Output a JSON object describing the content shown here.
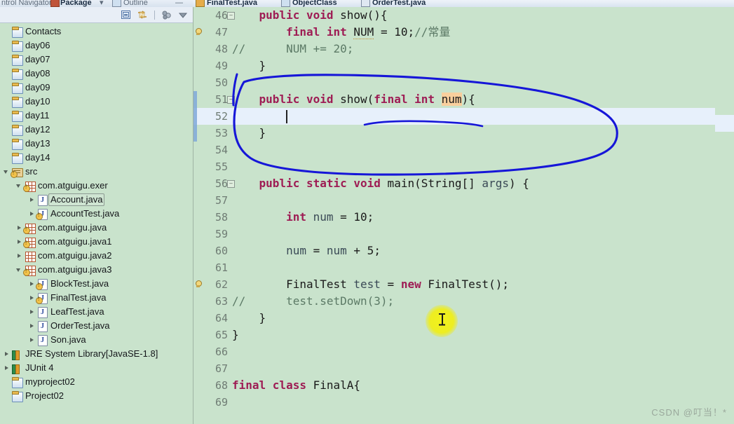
{
  "window": {
    "left_tabs": [
      {
        "label": "ntrol Navigator",
        "icon": "navigator-icon",
        "active": false
      },
      {
        "label": "Package",
        "icon": "package-explorer-icon",
        "active": true
      },
      {
        "label": "Outline",
        "icon": "outline-icon",
        "active": false
      }
    ],
    "editor_tabs": [
      {
        "label": "FinalTest.java",
        "icon": "java-file-icon",
        "active": true
      },
      {
        "label": "ObjectClass",
        "icon": "class-file-icon",
        "active": false
      },
      {
        "label": "OrderTest.java",
        "icon": "java-file-icon",
        "active": false
      }
    ]
  },
  "sidebar": {
    "toolbar": [
      {
        "name": "collapse-all-icon",
        "title": "Collapse All"
      },
      {
        "name": "link-with-editor-icon",
        "title": "Link with Editor"
      },
      {
        "name": "focus-on-active-task-icon",
        "title": "Focus"
      },
      {
        "name": "view-menu-icon",
        "title": "View Menu"
      }
    ],
    "tree": [
      {
        "label": "Contacts",
        "indent": 0,
        "arrow": "none",
        "icon": "project-icon",
        "warn": false,
        "selected": false
      },
      {
        "label": "day06",
        "indent": 0,
        "arrow": "none",
        "icon": "project-icon",
        "warn": false,
        "selected": false
      },
      {
        "label": "day07",
        "indent": 0,
        "arrow": "none",
        "icon": "project-icon",
        "warn": false,
        "selected": false
      },
      {
        "label": "day08",
        "indent": 0,
        "arrow": "none",
        "icon": "project-icon",
        "warn": false,
        "selected": false
      },
      {
        "label": "day09",
        "indent": 0,
        "arrow": "none",
        "icon": "project-icon",
        "warn": false,
        "selected": false
      },
      {
        "label": "day10",
        "indent": 0,
        "arrow": "none",
        "icon": "project-icon",
        "warn": false,
        "selected": false
      },
      {
        "label": "day11",
        "indent": 0,
        "arrow": "none",
        "icon": "project-icon",
        "warn": false,
        "selected": false
      },
      {
        "label": "day12",
        "indent": 0,
        "arrow": "none",
        "icon": "project-icon",
        "warn": false,
        "selected": false
      },
      {
        "label": "day13",
        "indent": 0,
        "arrow": "none",
        "icon": "project-icon",
        "warn": false,
        "selected": false
      },
      {
        "label": "day14",
        "indent": 0,
        "arrow": "none",
        "icon": "project-icon",
        "warn": false,
        "selected": false
      },
      {
        "label": "src",
        "indent": 0,
        "arrow": "open",
        "icon": "source-folder-icon",
        "warn": true,
        "selected": false
      },
      {
        "label": "com.atguigu.exer",
        "indent": 1,
        "arrow": "open",
        "icon": "package-icon",
        "warn": true,
        "selected": false
      },
      {
        "label": "Account.java",
        "indent": 2,
        "arrow": "closed",
        "icon": "java-file-icon",
        "warn": false,
        "selected": true
      },
      {
        "label": "AccountTest.java",
        "indent": 2,
        "arrow": "closed",
        "icon": "java-file-icon",
        "warn": true,
        "selected": false
      },
      {
        "label": "com.atguigu.java",
        "indent": 1,
        "arrow": "closed",
        "icon": "package-icon",
        "warn": true,
        "selected": false
      },
      {
        "label": "com.atguigu.java1",
        "indent": 1,
        "arrow": "closed",
        "icon": "package-icon",
        "warn": true,
        "selected": false
      },
      {
        "label": "com.atguigu.java2",
        "indent": 1,
        "arrow": "closed",
        "icon": "package-icon",
        "warn": false,
        "selected": false
      },
      {
        "label": "com.atguigu.java3",
        "indent": 1,
        "arrow": "open",
        "icon": "package-icon",
        "warn": true,
        "selected": false
      },
      {
        "label": "BlockTest.java",
        "indent": 2,
        "arrow": "closed",
        "icon": "java-file-icon",
        "warn": true,
        "selected": false
      },
      {
        "label": "FinalTest.java",
        "indent": 2,
        "arrow": "closed",
        "icon": "java-file-icon",
        "warn": true,
        "selected": false
      },
      {
        "label": "LeafTest.java",
        "indent": 2,
        "arrow": "closed",
        "icon": "java-file-icon",
        "warn": false,
        "selected": false
      },
      {
        "label": "OrderTest.java",
        "indent": 2,
        "arrow": "closed",
        "icon": "java-file-icon",
        "warn": false,
        "selected": false
      },
      {
        "label": "Son.java",
        "indent": 2,
        "arrow": "closed",
        "icon": "java-file-icon",
        "warn": false,
        "selected": false
      },
      {
        "label": "JRE System Library",
        "suffix": " [JavaSE-1.8]",
        "indent": 0,
        "arrow": "closed",
        "icon": "library-icon",
        "warn": false,
        "selected": false
      },
      {
        "label": "JUnit 4",
        "indent": 0,
        "arrow": "closed",
        "icon": "library-icon",
        "warn": false,
        "selected": false
      },
      {
        "label": "myproject02",
        "indent": 0,
        "arrow": "none",
        "icon": "project-icon",
        "warn": false,
        "selected": false
      },
      {
        "label": "Project02",
        "indent": 0,
        "arrow": "none",
        "icon": "project-icon",
        "warn": false,
        "selected": false
      }
    ]
  },
  "editor": {
    "first_line": 46,
    "current_line": 52,
    "caret_col": 8,
    "lines": [
      {
        "n": 46,
        "fold": true,
        "marker": "",
        "text": "    public void show(){",
        "tokens": [
          {
            "t": "    ",
            "c": ""
          },
          {
            "t": "public void",
            "c": "kw"
          },
          {
            "t": " show(){",
            "c": ""
          }
        ]
      },
      {
        "n": 47,
        "fold": false,
        "marker": "bulb",
        "text": "        final int NUM = 10;//常量",
        "tokens": [
          {
            "t": "        ",
            "c": ""
          },
          {
            "t": "final int",
            "c": "kw"
          },
          {
            "t": " ",
            "c": ""
          },
          {
            "t": "NUM",
            "c": "underdot"
          },
          {
            "t": " = 10;",
            "c": ""
          },
          {
            "t": "//常量",
            "c": "cm"
          }
        ]
      },
      {
        "n": 48,
        "fold": false,
        "marker": "",
        "text": "//      NUM += 20;",
        "tokens": [
          {
            "t": "//      NUM += 20;",
            "c": "cm"
          }
        ]
      },
      {
        "n": 49,
        "fold": false,
        "marker": "",
        "text": "    }",
        "tokens": [
          {
            "t": "    }",
            "c": ""
          }
        ]
      },
      {
        "n": 50,
        "fold": false,
        "marker": "",
        "text": "",
        "tokens": []
      },
      {
        "n": 51,
        "fold": true,
        "marker": "",
        "text": "    public void show(final int num){",
        "tokens": [
          {
            "t": "    ",
            "c": ""
          },
          {
            "t": "public void",
            "c": "kw"
          },
          {
            "t": " show(",
            "c": ""
          },
          {
            "t": "final int",
            "c": "kw"
          },
          {
            "t": " ",
            "c": ""
          },
          {
            "t": "num",
            "c": "hl"
          },
          {
            "t": "){",
            "c": ""
          }
        ]
      },
      {
        "n": 52,
        "fold": false,
        "marker": "",
        "text": "        ",
        "tokens": []
      },
      {
        "n": 53,
        "fold": false,
        "marker": "",
        "text": "    }",
        "tokens": [
          {
            "t": "    }",
            "c": ""
          }
        ]
      },
      {
        "n": 54,
        "fold": false,
        "marker": "",
        "text": "",
        "tokens": []
      },
      {
        "n": 55,
        "fold": false,
        "marker": "",
        "text": "",
        "tokens": []
      },
      {
        "n": 56,
        "fold": true,
        "marker": "",
        "text": "    public static void main(String[] args) {",
        "tokens": [
          {
            "t": "    ",
            "c": ""
          },
          {
            "t": "public static void",
            "c": "kw"
          },
          {
            "t": " main(String[] ",
            "c": ""
          },
          {
            "t": "args",
            "c": "fld"
          },
          {
            "t": ") {",
            "c": ""
          }
        ]
      },
      {
        "n": 57,
        "fold": false,
        "marker": "",
        "text": "",
        "tokens": []
      },
      {
        "n": 58,
        "fold": false,
        "marker": "",
        "text": "        int num = 10;",
        "tokens": [
          {
            "t": "        ",
            "c": ""
          },
          {
            "t": "int",
            "c": "kw"
          },
          {
            "t": " ",
            "c": ""
          },
          {
            "t": "num",
            "c": "fld"
          },
          {
            "t": " = 10;",
            "c": ""
          }
        ]
      },
      {
        "n": 59,
        "fold": false,
        "marker": "",
        "text": "",
        "tokens": []
      },
      {
        "n": 60,
        "fold": false,
        "marker": "",
        "text": "        num = num + 5;",
        "tokens": [
          {
            "t": "        ",
            "c": ""
          },
          {
            "t": "num",
            "c": "fld"
          },
          {
            "t": " = ",
            "c": ""
          },
          {
            "t": "num",
            "c": "fld"
          },
          {
            "t": " + 5;",
            "c": ""
          }
        ]
      },
      {
        "n": 61,
        "fold": false,
        "marker": "",
        "text": "",
        "tokens": []
      },
      {
        "n": 62,
        "fold": false,
        "marker": "bulb",
        "text": "        FinalTest test = new FinalTest();",
        "tokens": [
          {
            "t": "        FinalTest ",
            "c": ""
          },
          {
            "t": "test",
            "c": "fld"
          },
          {
            "t": " = ",
            "c": ""
          },
          {
            "t": "new",
            "c": "kw"
          },
          {
            "t": " FinalTest();",
            "c": ""
          }
        ]
      },
      {
        "n": 63,
        "fold": false,
        "marker": "",
        "text": "//      test.setDown(3);",
        "tokens": [
          {
            "t": "//      test.setDown(3);",
            "c": "cm"
          }
        ]
      },
      {
        "n": 64,
        "fold": false,
        "marker": "",
        "text": "    }",
        "tokens": [
          {
            "t": "    }",
            "c": ""
          }
        ]
      },
      {
        "n": 65,
        "fold": false,
        "marker": "",
        "text": "}",
        "tokens": [
          {
            "t": "}",
            "c": ""
          }
        ]
      },
      {
        "n": 66,
        "fold": false,
        "marker": "",
        "text": "",
        "tokens": []
      },
      {
        "n": 67,
        "fold": false,
        "marker": "",
        "text": "",
        "tokens": []
      },
      {
        "n": 68,
        "fold": false,
        "marker": "",
        "text": "final class FinalA{",
        "tokens": [
          {
            "t": "final class",
            "c": "kw"
          },
          {
            "t": " FinalA{",
            "c": ""
          }
        ]
      },
      {
        "n": 69,
        "fold": false,
        "marker": "",
        "text": "",
        "tokens": []
      }
    ]
  },
  "annotation": {
    "ellipse_color": "#1616d8",
    "underline_color": "#1616d8",
    "cursor_highlight_color": "#eded22"
  },
  "watermark": {
    "text": "CSDN @叮当！*"
  },
  "colors": {
    "editor_background": "#c9e3cc",
    "current_line": "#e7f0fb",
    "keyword": "#9e1c54",
    "comment": "#5c7a66",
    "field": "#3a4a56",
    "highlight_param": "#f9cf9d",
    "line_number": "#6f7c74"
  }
}
